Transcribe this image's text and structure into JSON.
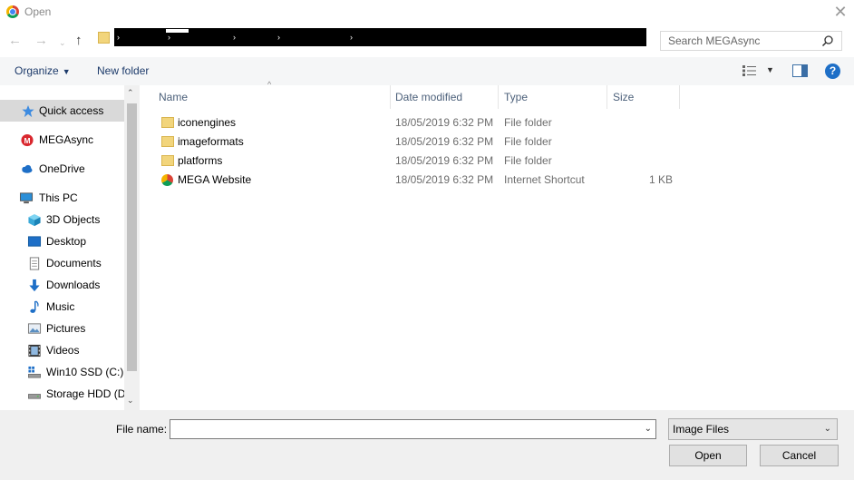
{
  "window": {
    "title": "Open",
    "close_icon": "close-icon"
  },
  "address": {
    "back_glyph": "←",
    "forward_glyph": "→",
    "recent_glyph": "⌄",
    "up_glyph": "↑",
    "separator_glyph": "›",
    "separator_count": 6
  },
  "search": {
    "placeholder": "Search MEGAsync"
  },
  "toolbar": {
    "organize_label": "Organize",
    "organize_caret": "▼",
    "new_folder_label": "New folder",
    "view_caret": "▼",
    "help_glyph": "?"
  },
  "nav": {
    "scroll_up": "⌃",
    "scroll_down": "⌄",
    "items": [
      {
        "label": "Quick access",
        "icon": "star-icon",
        "selected": true
      },
      {
        "label": "MEGAsync",
        "icon": "mega-icon"
      },
      {
        "label": "OneDrive",
        "icon": "cloud-icon"
      },
      {
        "label": "This PC",
        "icon": "computer-icon"
      },
      {
        "label": "3D Objects",
        "icon": "cube-icon"
      },
      {
        "label": "Desktop",
        "icon": "desktop-icon"
      },
      {
        "label": "Documents",
        "icon": "document-icon"
      },
      {
        "label": "Downloads",
        "icon": "download-icon"
      },
      {
        "label": "Music",
        "icon": "music-icon"
      },
      {
        "label": "Pictures",
        "icon": "picture-icon"
      },
      {
        "label": "Videos",
        "icon": "video-icon"
      },
      {
        "label": "Win10 SSD (C:)",
        "icon": "windows-drive-icon"
      },
      {
        "label": "Storage HDD (D:",
        "icon": "drive-icon"
      }
    ]
  },
  "columns": {
    "name": "Name",
    "date": "Date modified",
    "type": "Type",
    "size": "Size",
    "sort_glyph": "^"
  },
  "files": [
    {
      "name": "iconengines",
      "date": "18/05/2019 6:32 PM",
      "type": "File folder",
      "size": "",
      "icon": "folder-icon"
    },
    {
      "name": "imageformats",
      "date": "18/05/2019 6:32 PM",
      "type": "File folder",
      "size": "",
      "icon": "folder-icon"
    },
    {
      "name": "platforms",
      "date": "18/05/2019 6:32 PM",
      "type": "File folder",
      "size": "",
      "icon": "folder-icon"
    },
    {
      "name": "MEGA Website",
      "date": "18/05/2019 6:32 PM",
      "type": "Internet Shortcut",
      "size": "1 KB",
      "icon": "chrome-shortcut-icon"
    }
  ],
  "footer": {
    "file_name_label": "File name:",
    "file_name_value": "",
    "file_name_caret": "⌄",
    "filter_value": "Image Files",
    "filter_caret": "⌄",
    "open_label": "Open",
    "cancel_label": "Cancel"
  }
}
